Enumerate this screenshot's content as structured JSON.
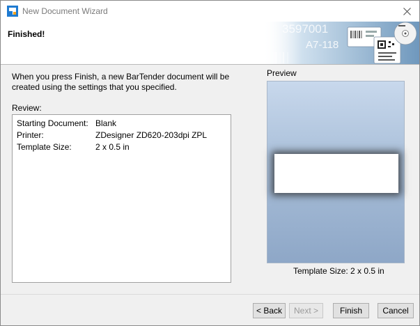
{
  "window": {
    "title": "New Document Wizard",
    "close_glyph": "✕"
  },
  "header": {
    "title": "Finished!",
    "graphic_text_1": "3597001",
    "graphic_text_2": "A7-118"
  },
  "main": {
    "instructions": "When you press Finish, a new BarTender document will be created using the settings that you specified.",
    "review_label": "Review:",
    "review": [
      {
        "key": "Starting Document:",
        "value": "Blank"
      },
      {
        "key": "Printer:",
        "value": "ZDesigner ZD620-203dpi ZPL"
      },
      {
        "key": "Template Size:",
        "value": "2 x 0.5 in"
      }
    ]
  },
  "preview": {
    "label": "Preview",
    "template_size": "Template Size:  2 x 0.5 in"
  },
  "buttons": {
    "back": "< Back",
    "next": "Next >",
    "finish": "Finish",
    "cancel": "Cancel"
  },
  "colors": {
    "accent_blue": "#1f7bd1",
    "accent_orange": "#f4a21d",
    "preview_top": "#c8d8ec",
    "preview_bottom": "#8ea7c7"
  }
}
